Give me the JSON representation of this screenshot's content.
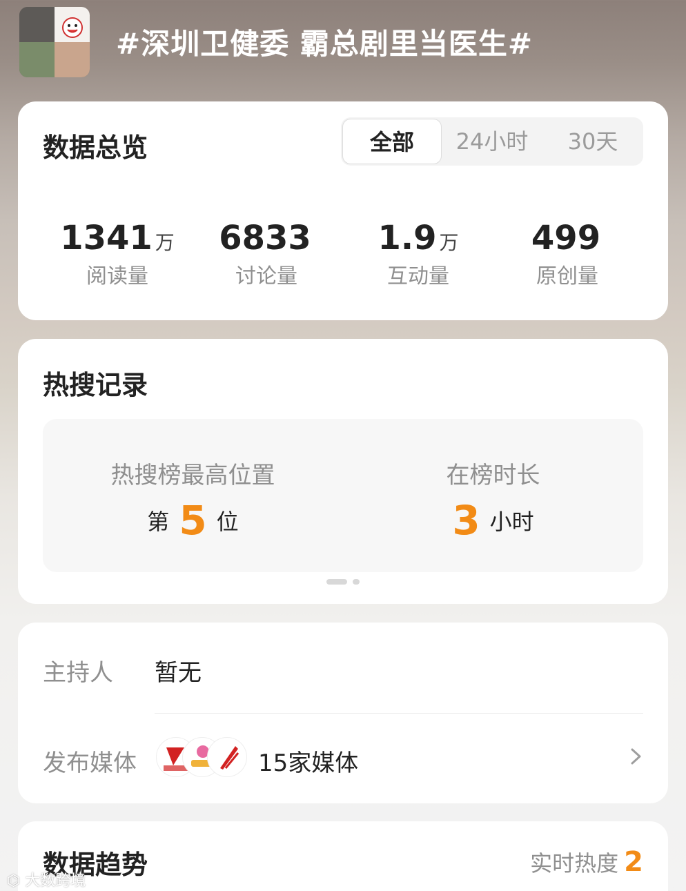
{
  "topic": {
    "title": "#深圳卫健委 霸总剧里当医生#"
  },
  "overview": {
    "title": "数据总览",
    "tabs": [
      {
        "label": "全部",
        "active": true
      },
      {
        "label": "24小时",
        "active": false
      },
      {
        "label": "30天",
        "active": false
      }
    ],
    "stats": [
      {
        "value": "1341",
        "unit": "万",
        "label": "阅读量"
      },
      {
        "value": "6833",
        "unit": "",
        "label": "讨论量"
      },
      {
        "value": "1.9",
        "unit": "万",
        "label": "互动量"
      },
      {
        "value": "499",
        "unit": "",
        "label": "原创量"
      }
    ]
  },
  "hot_search": {
    "title": "热搜记录",
    "peak": {
      "label": "热搜榜最高位置",
      "prefix": "第",
      "value": "5",
      "suffix": "位"
    },
    "duration": {
      "label": "在榜时长",
      "value": "3",
      "suffix": "小时"
    }
  },
  "info": {
    "host_label": "主持人",
    "host_value": "暂无",
    "media_label": "发布媒体",
    "media_value": "15家媒体"
  },
  "trend": {
    "title": "数据趋势",
    "heat_label": "实时热度",
    "heat_value": "2"
  },
  "watermark": "大数跨境",
  "colors": {
    "accent": "#f28b16",
    "text_primary": "#222222",
    "text_secondary": "#8f8f8f",
    "card_bg": "#ffffff"
  }
}
